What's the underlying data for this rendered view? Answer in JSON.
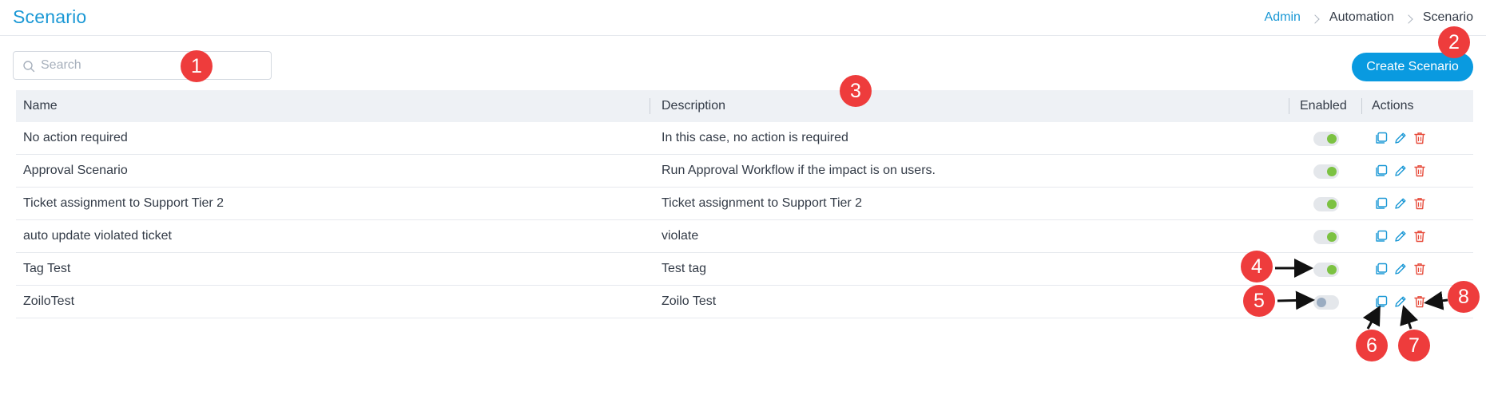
{
  "header": {
    "title": "Scenario",
    "breadcrumb": [
      "Admin",
      "Automation",
      "Scenario"
    ]
  },
  "toolbar": {
    "search_placeholder": "Search",
    "search_value": "",
    "create_label": "Create Scenario"
  },
  "table": {
    "columns": [
      "Name",
      "Description",
      "Enabled",
      "Actions"
    ],
    "rows": [
      {
        "name": "No action required",
        "description": "In this case, no action is required",
        "enabled": true
      },
      {
        "name": "Approval Scenario",
        "description": "Run Approval Workflow if the impact is on users.",
        "enabled": true
      },
      {
        "name": "Ticket assignment to Support Tier 2",
        "description": "Ticket assignment to Support Tier 2",
        "enabled": true
      },
      {
        "name": "auto update violated ticket",
        "description": "violate",
        "enabled": true
      },
      {
        "name": "Tag Test",
        "description": "Test tag",
        "enabled": true
      },
      {
        "name": "ZoiloTest",
        "description": "Zoilo Test",
        "enabled": false
      }
    ]
  },
  "callouts": [
    "1",
    "2",
    "3",
    "4",
    "5",
    "6",
    "7",
    "8"
  ],
  "colors": {
    "accent": "#1a98d5",
    "button": "#099ae0",
    "toggle_on": "#7cc242",
    "toggle_off": "#9aacc1",
    "delete": "#e74c3c",
    "callout": "#ee3c3c"
  },
  "icons": {
    "search": "search-icon",
    "clone": "copy-icon",
    "edit": "pencil-icon",
    "delete": "trash-icon"
  }
}
